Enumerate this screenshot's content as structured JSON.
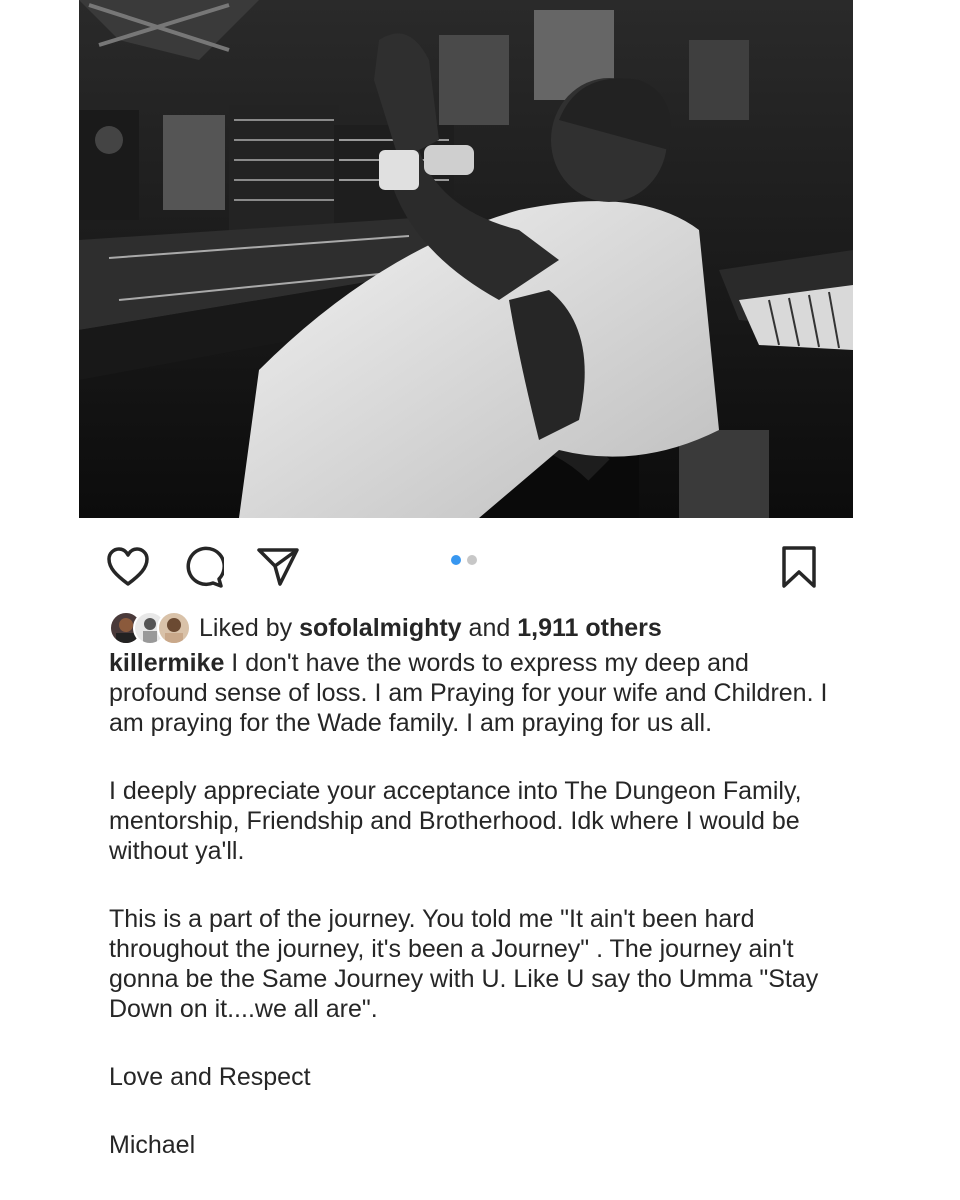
{
  "post": {
    "photo_alt": "",
    "carousel": {
      "count": 2,
      "active_index": 0
    },
    "actions": {
      "like_icon": "heart-icon",
      "comment_icon": "comment-icon",
      "share_icon": "paper-plane-icon",
      "save_icon": "bookmark-icon",
      "mute_icon": "speaker-muted-icon"
    },
    "likes": {
      "prefix": "Liked by",
      "user": "sofolalmighty",
      "conj": "and",
      "others": "1,911 others"
    },
    "caption": {
      "username": "killermike",
      "para1": " I don't have the words to express my deep and profound sense of loss.  I am Praying for your wife and Children.  I am praying for the Wade family.  I am praying for us all.",
      "para2": "I deeply appreciate your acceptance into The Dungeon Family, mentorship, Friendship and Brotherhood.  Idk where I would be without ya'll.",
      "para3": "This is a part of the journey.  You told me \"It ain't been hard throughout the journey, it's been a Journey\" .  The journey ain't gonna be the Same Journey with U.  Like U say tho Umma \"Stay Down on it....we all are\".",
      "para4": "Love and Respect",
      "para5": "Michael"
    }
  },
  "colors": {
    "accent_dot": "#3897f0",
    "text": "#262626",
    "inactive_dot": "#c7c7c7"
  }
}
